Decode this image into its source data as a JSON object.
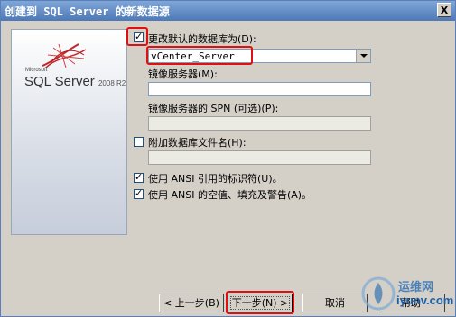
{
  "window": {
    "title": "创建到 SQL Server 的新数据源",
    "close_glyph": "X"
  },
  "logo": {
    "brand_small": "Microsoft",
    "product": "SQL Server",
    "version": "2008 R2"
  },
  "form": {
    "change_default_db": {
      "label": "更改默认的数据库为(D):",
      "checked": true
    },
    "database": {
      "value": "vCenter_Server"
    },
    "mirror_server": {
      "label": "镜像服务器(M):",
      "value": ""
    },
    "mirror_spn": {
      "label": "镜像服务器的 SPN (可选)(P):",
      "value": ""
    },
    "attach_db_file": {
      "label": "附加数据库文件名(H):",
      "checked": false,
      "value": ""
    },
    "ansi_quoted": {
      "label": "使用 ANSI 引用的标识符(U)。",
      "checked": true
    },
    "ansi_nulls": {
      "label": "使用 ANSI 的空值、填充及警告(A)。",
      "checked": true
    }
  },
  "buttons": {
    "back": "< 上一步(B)",
    "next": "下一步(N) >",
    "cancel": "取消",
    "help": "帮助"
  },
  "watermark": {
    "line1": "运维网",
    "line2": "iyunv.com"
  },
  "colors": {
    "highlight": "#e01010",
    "titlebar": "#4e79b6",
    "dialog": "#d4d0c8"
  }
}
